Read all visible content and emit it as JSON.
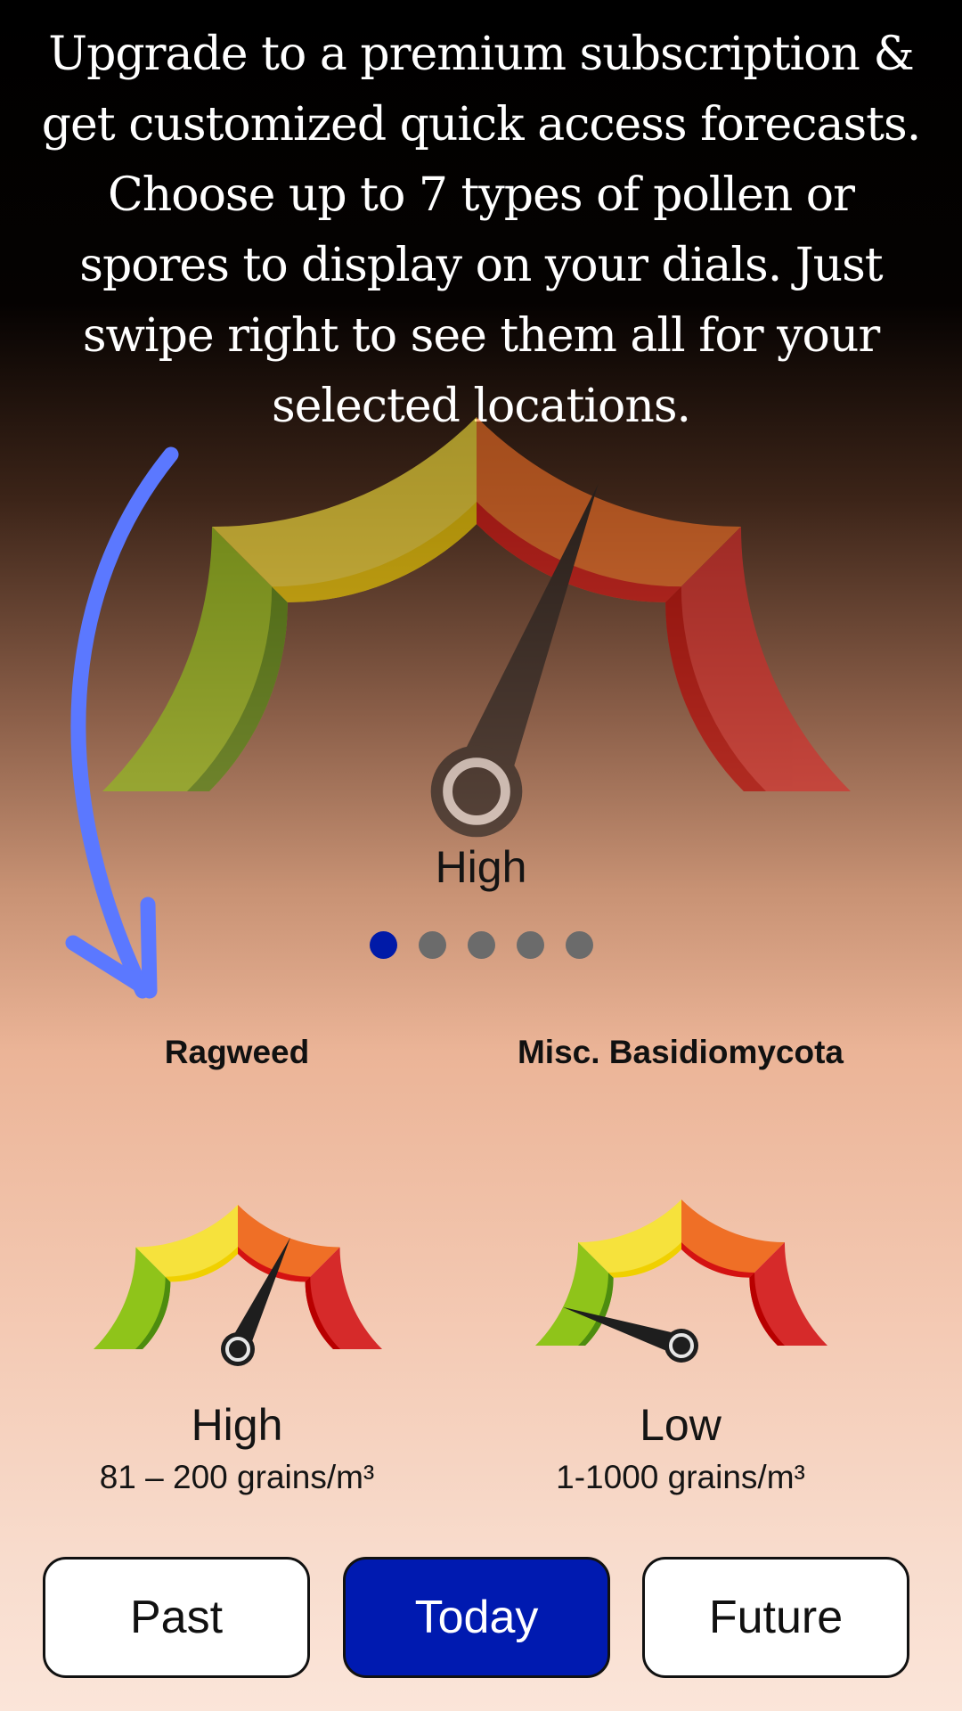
{
  "promo": {
    "text": "Upgrade to a premium subscription & get customized quick access forecasts. Choose up to 7 types of pollen or spores to display on your dials. Just swipe right to see them all for your selected locations."
  },
  "main_gauge": {
    "level_label": "High",
    "level_fraction": 0.62
  },
  "pager": {
    "count": 5,
    "active_index": 0
  },
  "gauges": [
    {
      "name": "Ragweed",
      "level_label": "High",
      "range": "81 – 200 grains/m³",
      "level_fraction": 0.64
    },
    {
      "name": "Misc. Basidiomycota",
      "level_label": "Low",
      "range": "1-1000 grains/m³",
      "level_fraction": 0.1
    }
  ],
  "buttons": {
    "past": "Past",
    "today": "Today",
    "future": "Future",
    "selected": "today"
  },
  "colors": {
    "low": "#8fc41a",
    "moderate": "#f6e23c",
    "high": "#ef6f26",
    "very_high": "#d62a2a",
    "accent": "#001ab0",
    "swipe_arrow": "#5b78ff"
  },
  "icons": {
    "swipe_hint": "curved-arrow-icon"
  }
}
